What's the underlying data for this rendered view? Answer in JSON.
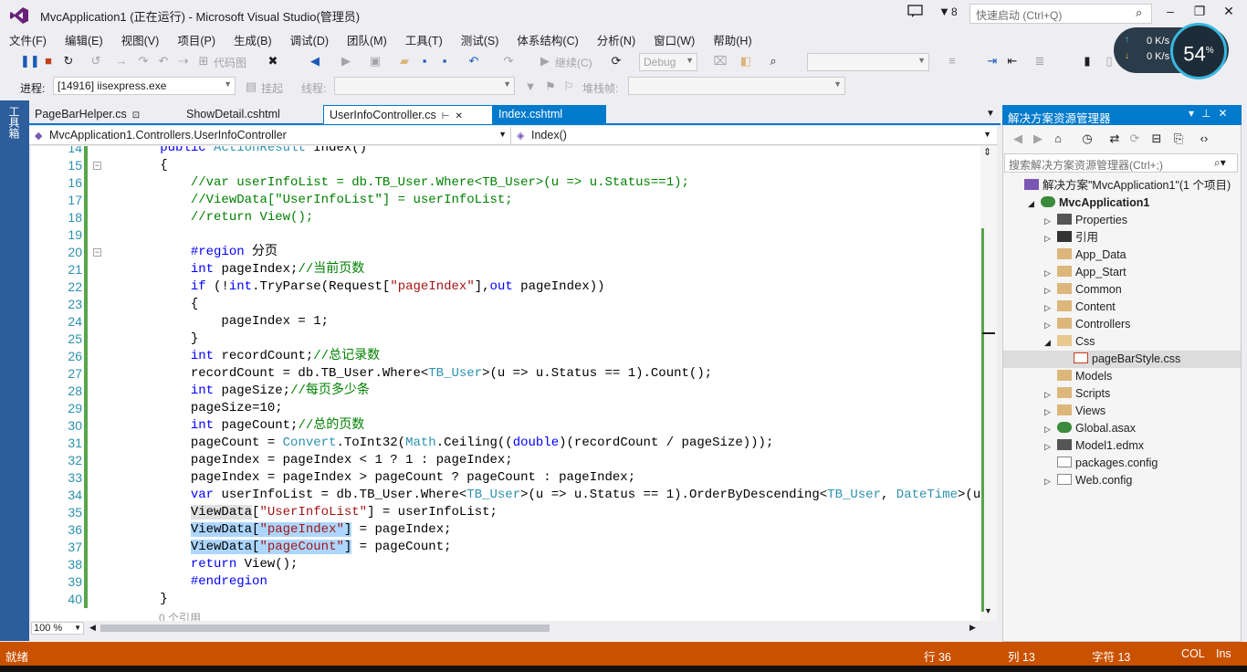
{
  "window": {
    "title": "MvcApplication1 (正在运行) - Microsoft Visual Studio(管理员)",
    "feedback_count": "8",
    "quick_launch_placeholder": "快速启动 (Ctrl+Q)"
  },
  "menu": [
    "文件(F)",
    "编辑(E)",
    "视图(V)",
    "项目(P)",
    "生成(B)",
    "调试(D)",
    "团队(M)",
    "工具(T)",
    "测试(S)",
    "体系结构(C)",
    "分析(N)",
    "窗口(W)",
    "帮助(H)"
  ],
  "toolbar": {
    "code_map": "代码图",
    "continue": "继续(C)",
    "config": "Debug",
    "process_label": "进程:",
    "process_value": "[14916] iisexpress.exe",
    "suspend": "挂起",
    "thread_label": "线程:",
    "stack_label": "堆栈帧:"
  },
  "speed": {
    "up": "0 K/s",
    "down": "0 K/s",
    "percent": "54",
    "percent_sign": "%"
  },
  "toolbox_label": "工具箱",
  "tabs": [
    {
      "label": "PageBarHelper.cs"
    },
    {
      "label": "ShowDetail.cshtml"
    },
    {
      "label": "UserInfoController.cs"
    },
    {
      "label": "Index.cshtml"
    }
  ],
  "nav": {
    "class_path": "MvcApplication1.Controllers.UserInfoController",
    "member": "Index()"
  },
  "code": {
    "lines": [
      {
        "n": "14",
        "parts": [
          [
            "",
            "        "
          ],
          [
            "kw",
            "public"
          ],
          [
            "",
            " "
          ],
          [
            "ty",
            "ActionResult"
          ],
          [
            "",
            " Index()"
          ]
        ]
      },
      {
        "n": "15",
        "parts": [
          [
            "",
            "        {"
          ]
        ]
      },
      {
        "n": "16",
        "parts": [
          [
            "",
            "            "
          ],
          [
            "cm",
            "//var userInfoList = db.TB_User.Where<TB_User>(u => u.Status==1);"
          ]
        ]
      },
      {
        "n": "17",
        "parts": [
          [
            "",
            "            "
          ],
          [
            "cm",
            "//ViewData[\"UserInfoList\"] = userInfoList;"
          ]
        ]
      },
      {
        "n": "18",
        "parts": [
          [
            "",
            "            "
          ],
          [
            "cm",
            "//return View();"
          ]
        ]
      },
      {
        "n": "19",
        "parts": [
          [
            "",
            ""
          ]
        ]
      },
      {
        "n": "20",
        "parts": [
          [
            "",
            "            "
          ],
          [
            "pp",
            "#region"
          ],
          [
            "",
            " 分页"
          ]
        ]
      },
      {
        "n": "21",
        "parts": [
          [
            "",
            "            "
          ],
          [
            "kw",
            "int"
          ],
          [
            "",
            " pageIndex;"
          ],
          [
            "cm",
            "//当前页数"
          ]
        ]
      },
      {
        "n": "22",
        "parts": [
          [
            "",
            "            "
          ],
          [
            "kw",
            "if"
          ],
          [
            "",
            " (!"
          ],
          [
            "kw",
            "int"
          ],
          [
            "",
            ".TryParse(Request["
          ],
          [
            "str",
            "\"pageIndex\""
          ],
          [
            "",
            "],"
          ],
          [
            "kw",
            "out"
          ],
          [
            "",
            " pageIndex))"
          ]
        ]
      },
      {
        "n": "23",
        "parts": [
          [
            "",
            "            {"
          ]
        ]
      },
      {
        "n": "24",
        "parts": [
          [
            "",
            "                pageIndex = 1;"
          ]
        ]
      },
      {
        "n": "25",
        "parts": [
          [
            "",
            "            }"
          ]
        ]
      },
      {
        "n": "26",
        "parts": [
          [
            "",
            "            "
          ],
          [
            "kw",
            "int"
          ],
          [
            "",
            " recordCount;"
          ],
          [
            "cm",
            "//总记录数"
          ]
        ]
      },
      {
        "n": "27",
        "parts": [
          [
            "",
            "            recordCount = db.TB_User.Where<"
          ],
          [
            "ty",
            "TB_User"
          ],
          [
            "",
            ">(u => u.Status == 1).Count();"
          ]
        ]
      },
      {
        "n": "28",
        "parts": [
          [
            "",
            "            "
          ],
          [
            "kw",
            "int"
          ],
          [
            "",
            " pageSize;"
          ],
          [
            "cm",
            "//每页多少条"
          ]
        ]
      },
      {
        "n": "29",
        "parts": [
          [
            "",
            "            pageSize=10;"
          ]
        ]
      },
      {
        "n": "30",
        "parts": [
          [
            "",
            "            "
          ],
          [
            "kw",
            "int"
          ],
          [
            "",
            " pageCount;"
          ],
          [
            "cm",
            "//总的页数"
          ]
        ]
      },
      {
        "n": "31",
        "parts": [
          [
            "",
            "            pageCount = "
          ],
          [
            "ty",
            "Convert"
          ],
          [
            "",
            ".ToInt32("
          ],
          [
            "ty",
            "Math"
          ],
          [
            "",
            ".Ceiling(("
          ],
          [
            "kw",
            "double"
          ],
          [
            "",
            ")(recordCount / pageSize)));"
          ]
        ]
      },
      {
        "n": "32",
        "parts": [
          [
            "",
            "            pageIndex = pageIndex < 1 ? 1 : pageIndex;"
          ]
        ]
      },
      {
        "n": "33",
        "parts": [
          [
            "",
            "            pageIndex = pageIndex > pageCount ? pageCount : pageIndex;"
          ]
        ]
      },
      {
        "n": "34",
        "parts": [
          [
            "",
            "            "
          ],
          [
            "kw",
            "var"
          ],
          [
            "",
            " userInfoList = db.TB_User.Where<"
          ],
          [
            "ty",
            "TB_User"
          ],
          [
            "",
            ">(u => u.Status == 1).OrderByDescending<"
          ],
          [
            "ty",
            "TB_User"
          ],
          [
            "",
            ", "
          ],
          [
            "ty",
            "DateTime"
          ],
          [
            "",
            ">(u => (D"
          ]
        ]
      },
      {
        "n": "35",
        "parts": [
          [
            "",
            "            "
          ],
          [
            "hl2",
            "ViewData"
          ],
          [
            "",
            "["
          ],
          [
            "str",
            "\"UserInfoList\""
          ],
          [
            "",
            "] = userInfoList;"
          ]
        ]
      },
      {
        "n": "36",
        "parts": [
          [
            "",
            "            "
          ],
          [
            "hl",
            "ViewData["
          ],
          [
            "hlstr",
            "\"pageIndex\""
          ],
          [
            "hl",
            "]"
          ],
          [
            "",
            " = pageIndex;"
          ]
        ]
      },
      {
        "n": "37",
        "parts": [
          [
            "",
            "            "
          ],
          [
            "hl",
            "ViewData["
          ],
          [
            "hlstr",
            "\"pageCount\""
          ],
          [
            "hl",
            "]"
          ],
          [
            "",
            " = pageCount;"
          ]
        ]
      },
      {
        "n": "38",
        "parts": [
          [
            "",
            "            "
          ],
          [
            "kw",
            "return"
          ],
          [
            "",
            " View();"
          ]
        ]
      },
      {
        "n": "39",
        "parts": [
          [
            "",
            "            "
          ],
          [
            "pp",
            "#endregion"
          ]
        ]
      },
      {
        "n": "40",
        "parts": [
          [
            "",
            "        }"
          ]
        ]
      }
    ],
    "codelens": "0 个引用",
    "zoom": "100 %"
  },
  "solution_explorer": {
    "title": "解决方案资源管理器",
    "search_placeholder": "搜索解决方案资源管理器(Ctrl+;)",
    "items": [
      {
        "label": "解决方案\"MvcApplication1\"(1 个项目)",
        "depth": 0,
        "exp": "",
        "icon": "solution-icon"
      },
      {
        "label": "MvcApplication1",
        "depth": 1,
        "exp": "◢",
        "icon": "project-icon",
        "bold": true
      },
      {
        "label": "Properties",
        "depth": 2,
        "exp": "▷",
        "icon": "wrench-icon"
      },
      {
        "label": "引用",
        "depth": 2,
        "exp": "▷",
        "icon": "references-icon"
      },
      {
        "label": "App_Data",
        "depth": 2,
        "exp": "",
        "icon": "folder-icon"
      },
      {
        "label": "App_Start",
        "depth": 2,
        "exp": "▷",
        "icon": "folder-icon"
      },
      {
        "label": "Common",
        "depth": 2,
        "exp": "▷",
        "icon": "folder-icon"
      },
      {
        "label": "Content",
        "depth": 2,
        "exp": "▷",
        "icon": "folder-icon"
      },
      {
        "label": "Controllers",
        "depth": 2,
        "exp": "▷",
        "icon": "folder-icon"
      },
      {
        "label": "Css",
        "depth": 2,
        "exp": "◢",
        "icon": "folder-open-icon"
      },
      {
        "label": "pageBarStyle.css",
        "depth": 3,
        "exp": "",
        "icon": "css-file-icon"
      },
      {
        "label": "Models",
        "depth": 2,
        "exp": "",
        "icon": "folder-icon"
      },
      {
        "label": "Scripts",
        "depth": 2,
        "exp": "▷",
        "icon": "folder-icon"
      },
      {
        "label": "Views",
        "depth": 2,
        "exp": "▷",
        "icon": "folder-icon"
      },
      {
        "label": "Global.asax",
        "depth": 2,
        "exp": "▷",
        "icon": "globe-icon"
      },
      {
        "label": "Model1.edmx",
        "depth": 2,
        "exp": "▷",
        "icon": "edmx-icon"
      },
      {
        "label": "packages.config",
        "depth": 2,
        "exp": "",
        "icon": "config-file-icon"
      },
      {
        "label": "Web.config",
        "depth": 2,
        "exp": "▷",
        "icon": "config-file-icon"
      }
    ]
  },
  "status": {
    "state": "就绪",
    "row": "行 36",
    "col": "列 13",
    "char": "字符 13",
    "col_mode": "COL",
    "ins": "Ins"
  },
  "colors": {
    "accent": "#007acc",
    "statusbar_debug": "#ca5100",
    "keyword": "#0000ff",
    "type": "#2b91af",
    "string": "#a31515",
    "comment": "#008000"
  }
}
